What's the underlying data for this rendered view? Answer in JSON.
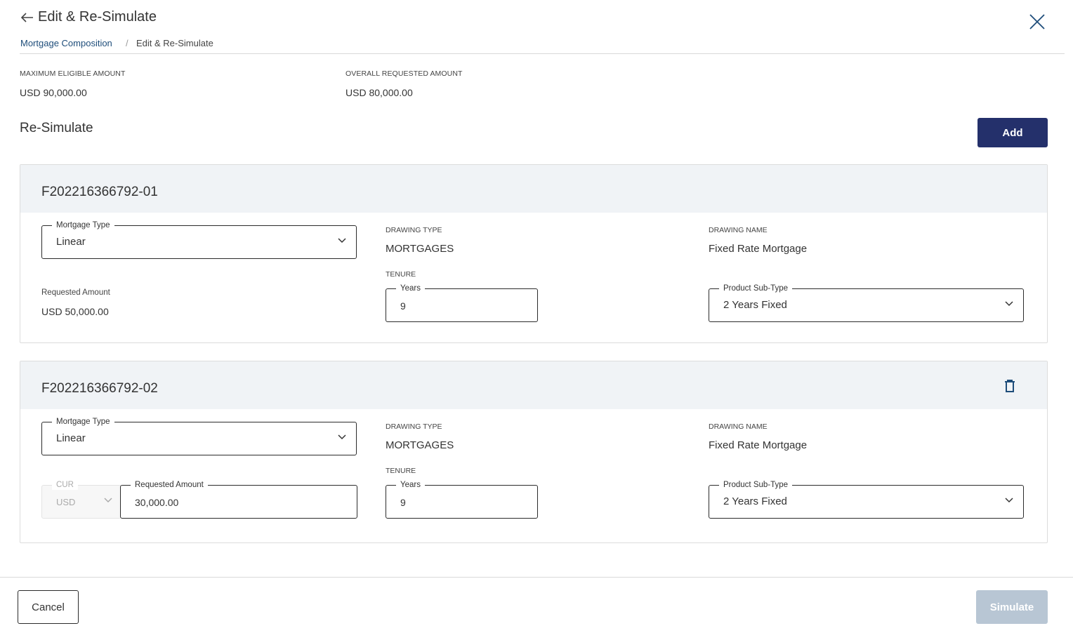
{
  "header": {
    "back_icon": "arrow-left-icon",
    "title": "Edit & Re-Simulate",
    "close_icon": "close-icon"
  },
  "breadcrumb": {
    "parent": "Mortgage Composition",
    "separator": "/",
    "current": "Edit & Re-Simulate"
  },
  "summary": {
    "max_label": "MAXIMUM ELIGIBLE AMOUNT",
    "max_value": "USD 90,000.00",
    "overall_label": "OVERALL REQUESTED AMOUNT",
    "overall_value": "USD 80,000.00"
  },
  "section": {
    "title": "Re-Simulate",
    "add_label": "Add"
  },
  "cards": [
    {
      "id": "F202216366792-01",
      "mortgage_type_label": "Mortgage Type",
      "mortgage_type_value": "Linear",
      "drawing_type_label": "DRAWING TYPE",
      "drawing_type_value": "MORTGAGES",
      "drawing_name_label": "DRAWING NAME",
      "drawing_name_value": "Fixed Rate Mortgage",
      "requested_amount_label": "Requested Amount",
      "requested_amount_value": "USD 50,000.00",
      "tenure_label": "TENURE",
      "years_label": "Years",
      "years_value": "9",
      "product_subtype_label": "Product Sub-Type",
      "product_subtype_value": "2 Years Fixed"
    },
    {
      "id": "F202216366792-02",
      "delete_icon": "trash-icon",
      "mortgage_type_label": "Mortgage Type",
      "mortgage_type_value": "Linear",
      "drawing_type_label": "DRAWING TYPE",
      "drawing_type_value": "MORTGAGES",
      "drawing_name_label": "DRAWING NAME",
      "drawing_name_value": "Fixed Rate Mortgage",
      "currency_label": "CUR",
      "currency_value": "USD",
      "requested_amount_label": "Requested Amount",
      "requested_amount_value": "30,000.00",
      "tenure_label": "TENURE",
      "years_label": "Years",
      "years_value": "9",
      "product_subtype_label": "Product Sub-Type",
      "product_subtype_value": "2 Years Fixed"
    }
  ],
  "footer": {
    "cancel_label": "Cancel",
    "simulate_label": "Simulate"
  },
  "colors": {
    "primary": "#24306b",
    "link": "#1e4d7a",
    "card_header_bg": "#f0f3f6",
    "disabled_button": "#b8c6d4"
  }
}
